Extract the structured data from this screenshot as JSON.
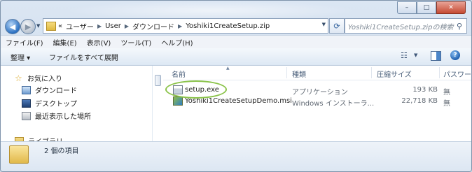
{
  "window": {
    "controls": [
      "–",
      "□",
      "✕"
    ]
  },
  "nav": {
    "address_crumbs": [
      "«",
      "ユーザー",
      "User",
      "ダウンロード",
      "Yoshiki1CreateSetup.zip"
    ],
    "search_placeholder": "Yoshiki1CreateSetup.zipの検索"
  },
  "menubar": [
    "ファイル(F)",
    "編集(E)",
    "表示(V)",
    "ツール(T)",
    "ヘルプ(H)"
  ],
  "commandbar": {
    "organize": "整理 ▾",
    "extract_all": "ファイルをすべて展開"
  },
  "navpane": {
    "favorites": "お気に入り",
    "downloads": "ダウンロード",
    "desktop": "デスクトップ",
    "recent": "最近表示した場所",
    "libraries": "ライブラリ"
  },
  "filelist": {
    "columns": {
      "name": "名前",
      "type": "種類",
      "compressed_size": "圧縮サイズ",
      "password": "パスワー"
    },
    "rows": [
      {
        "name": "setup.exe",
        "type": "アプリケーション",
        "size": "193 KB",
        "password": "無"
      },
      {
        "name": "Yoshiki1CreateSetupDemo.msi",
        "type": "Windows インストーラ...",
        "size": "22,718 KB",
        "password": "無"
      }
    ]
  },
  "details": {
    "item_count": "2 個の項目"
  },
  "colors": {
    "highlight_ring": "#8bc34a",
    "accent": "#2b70c1"
  }
}
